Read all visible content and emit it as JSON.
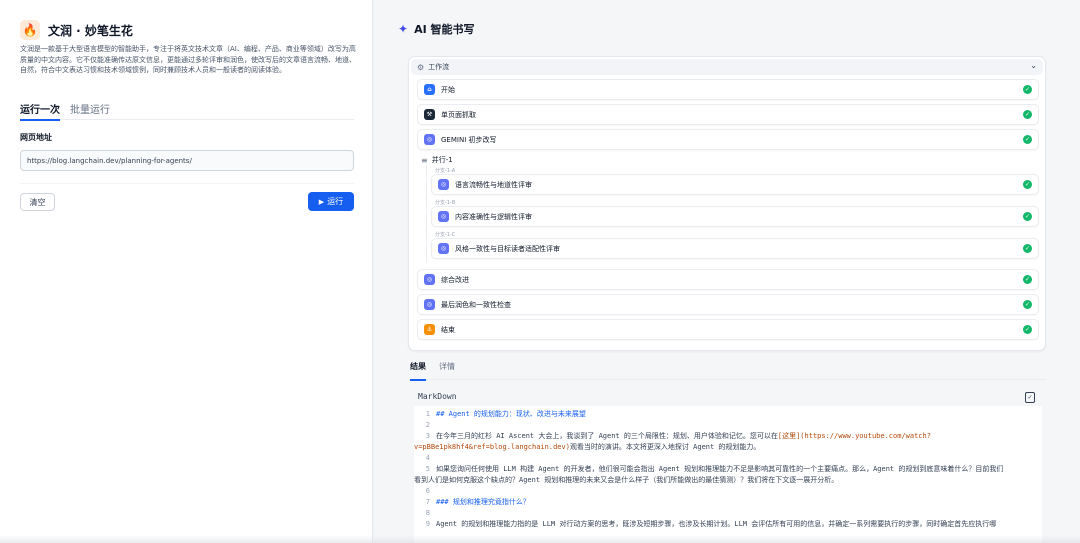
{
  "app": {
    "icon": "🔥",
    "title": "文润 · 妙笔生花",
    "description": "文润是一款基于大型语言模型的智能助手，专注于将英文技术文章（AI、编程、产品、商业等领域）改写为高质量的中文内容。它不仅能准确传达原文信息，更能通过多轮评审和润色，使改写后的文章语言流畅、地道、自然，符合中文表达习惯和技术领域惯例，同时兼顾技术人员和一般读者的阅读体验。"
  },
  "tabs": [
    "运行一次",
    "批量运行"
  ],
  "form": {
    "url_label": "网页地址",
    "url_value": "https://blog.langchain.dev/planning-for-agents/"
  },
  "buttons": {
    "clear": "清空",
    "run": "运行"
  },
  "right": {
    "title": "AI 智能书写",
    "workflow_label": "工作流",
    "nodes": [
      {
        "label": "开始",
        "icon": "home-icon",
        "color": "#2970ff"
      },
      {
        "label": "单页面抓取",
        "icon": "tool-icon",
        "color": "#1d2939"
      },
      {
        "label": "GEMINI 初步改写",
        "icon": "llm-icon",
        "color": "#6172f3"
      },
      {
        "label": "语言流畅性与地道性评审",
        "icon": "llm-icon",
        "color": "#6172f3"
      },
      {
        "label": "内容准确性与逻辑性评审",
        "icon": "llm-icon",
        "color": "#6172f3"
      },
      {
        "label": "风格一致性与目标读者适配性评审",
        "icon": "llm-icon",
        "color": "#6172f3"
      },
      {
        "label": "综合改进",
        "icon": "llm-icon",
        "color": "#6172f3"
      },
      {
        "label": "最后润色和一致性检查",
        "icon": "llm-icon",
        "color": "#6172f3"
      },
      {
        "label": "结束",
        "icon": "end-icon",
        "color": "#f79009"
      }
    ],
    "parallel_label": "并行-1",
    "branches": [
      "分支-1-A",
      "分支-1-B",
      "分支-1-C"
    ],
    "result_tabs": [
      "结果",
      "详情"
    ],
    "markdown_label": "MarkDown",
    "code": {
      "l1": "## Agent 的规划能力：现状、改进与未来展望",
      "l3a": "在今年三月的红杉 AI Ascent 大会上，我谈到了 Agent 的三个局限性：规划、用户体验和记忆。您可以在",
      "l3b": "[这里]",
      "l3c": "(https://www.youtube.com/watch?",
      "l3d": "v=pBBe1pk8hf4&ref=blog.langchain.dev)",
      "l3e": "观看当时的演讲。本文将更深入地探讨 Agent 的规划能力。",
      "l5a": "如果您询问任何使用 LLM 构建 Agent 的开发者，他们很可能会指出 Agent 规划和推理能力不足是影响其可靠性的一个主要痛点。那么，Agent 的规划到底意味着什么？目前我们",
      "l5b": "看到人们是如何克服这个缺点的？Agent 规划和推理的未来又会是什么样子（我们所能做出的最佳猜测）？我们将在下文逐一展开分析。",
      "l7": "### 规划和推理究竟指什么？",
      "l9": "Agent 的规划和推理能力指的是 LLM 对行动方案的思考，既涉及短期步骤，也涉及长期计划。LLM 会评估所有可用的信息，并确定一系列需要执行的步骤，同时确定首先应执行哪"
    }
  }
}
